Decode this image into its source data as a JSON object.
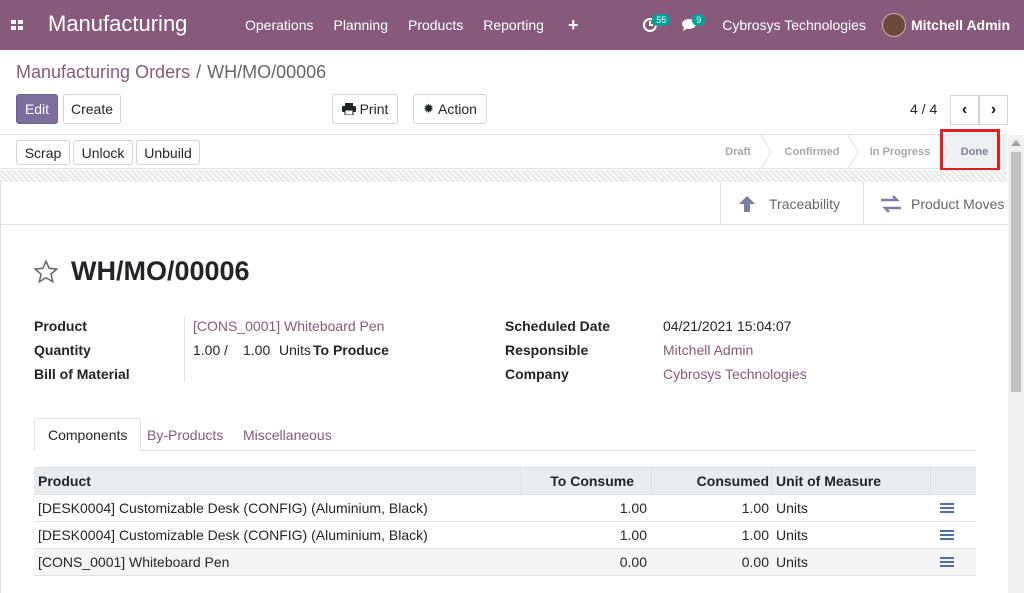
{
  "app": {
    "title": "Manufacturing"
  },
  "nav": {
    "items": [
      "Operations",
      "Planning",
      "Products",
      "Reporting"
    ],
    "plus": "+"
  },
  "systray": {
    "activity_count": "55",
    "messages_count": "9",
    "company": "Cybrosys Technologies",
    "user": "Mitchell Admin"
  },
  "breadcrumb": {
    "parent": "Manufacturing Orders",
    "sep": "/",
    "current": "WH/MO/00006"
  },
  "toolbar": {
    "edit": "Edit",
    "create": "Create",
    "print": "Print",
    "action": "Action"
  },
  "pager": {
    "text": "4 / 4"
  },
  "status_buttons": {
    "scrap": "Scrap",
    "unlock": "Unlock",
    "unbuild": "Unbuild"
  },
  "stages": [
    "Draft",
    "Confirmed",
    "In Progress",
    "Done"
  ],
  "current_stage": "Done",
  "smart_buttons": {
    "traceability": "Traceability",
    "product_moves": "Product Moves"
  },
  "record": {
    "name": "WH/MO/00006",
    "fields_left": {
      "product_label": "Product",
      "product_value": "[CONS_0001] Whiteboard Pen",
      "quantity_label": "Quantity",
      "qty_done": "1.00",
      "qty_sep": "/",
      "qty_total": "1.00",
      "qty_uom": "Units",
      "qty_suffix": "To Produce",
      "bom_label": "Bill of Material"
    },
    "fields_right": {
      "scheduled_label": "Scheduled Date",
      "scheduled_value": "04/21/2021 15:04:07",
      "responsible_label": "Responsible",
      "responsible_value": "Mitchell Admin",
      "company_label": "Company",
      "company_value": "Cybrosys Technologies"
    }
  },
  "tabs": [
    "Components",
    "By-Products",
    "Miscellaneous"
  ],
  "components": {
    "headers": [
      "Product",
      "To Consume",
      "Consumed",
      "Unit of Measure"
    ],
    "rows": [
      [
        "[DESK0004] Customizable Desk (CONFIG) (Aluminium, Black)",
        "1.00",
        "1.00",
        "Units"
      ],
      [
        "[DESK0004] Customizable Desk (CONFIG) (Aluminium, Black)",
        "1.00",
        "1.00",
        "Units"
      ],
      [
        "[CONS_0001] Whiteboard Pen",
        "0.00",
        "0.00",
        "Units"
      ]
    ]
  },
  "colors": {
    "brand": "#875a7b",
    "highlight": "#e01f1f",
    "primary_button": "#7c6f9e"
  }
}
